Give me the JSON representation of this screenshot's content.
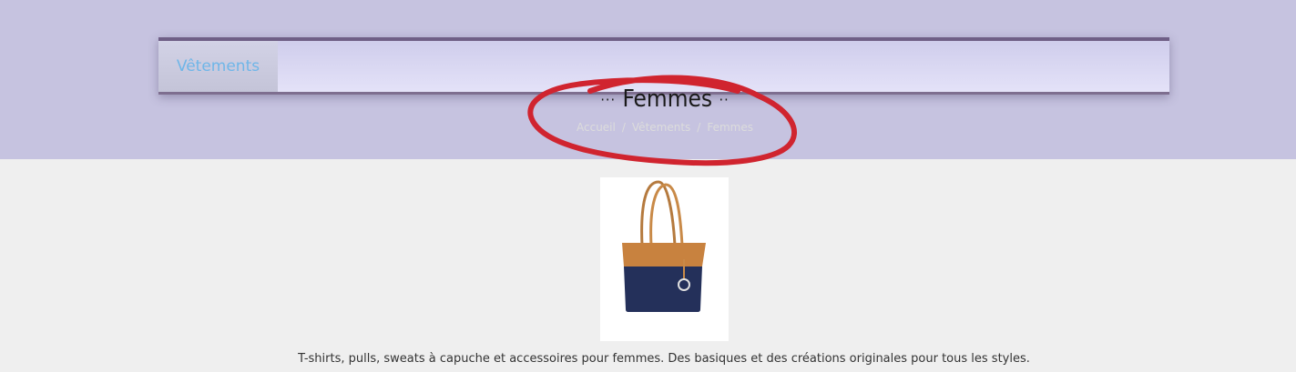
{
  "nav": {
    "items": [
      {
        "label": "Vêtements"
      }
    ]
  },
  "category": {
    "title": "Femmes",
    "title_prefix": "···",
    "title_suffix": "··"
  },
  "breadcrumb": {
    "items": [
      "Accueil",
      "Vêtements",
      "Femmes"
    ],
    "separator": "/"
  },
  "product": {
    "image": "handbag-image"
  },
  "description": "T-shirts, pulls, sweats à capuche et accessoires pour femmes. Des basiques et des créations originales pour tous les styles.",
  "colors": {
    "hero_bg": "#c6c3e0",
    "nav_border": "#6f5f86",
    "nav_link": "#6fb6e8",
    "annotation": "#d0242f",
    "page_bg": "#efefef"
  }
}
